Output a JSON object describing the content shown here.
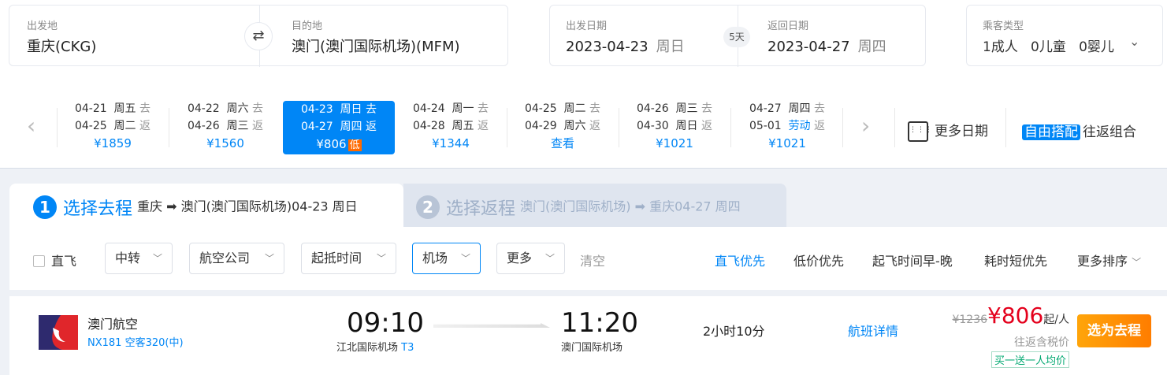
{
  "search": {
    "from_label": "出发地",
    "from_value": "重庆(CKG)",
    "to_label": "目的地",
    "to_value": "澳门(澳门国际机场)(MFM)",
    "depart_label": "出发日期",
    "depart_date": "2023-04-23",
    "depart_week": "周日",
    "days": "5天",
    "return_label": "返回日期",
    "return_date": "2023-04-27",
    "return_week": "周四",
    "pax_label": "乘客类型",
    "adults": "1成人",
    "children": "0儿童",
    "infants": "0婴儿"
  },
  "date_strip": [
    {
      "go": "04-21  周五",
      "back": "04-25  周二",
      "price": "¥1859"
    },
    {
      "go": "04-22  周六",
      "back": "04-26  周三",
      "price": "¥1560"
    },
    {
      "go": "04-23  周日",
      "back": "04-27  周四",
      "price": "¥806",
      "badge": "低"
    },
    {
      "go": "04-24  周一",
      "back": "04-28  周五",
      "price": "¥1344"
    },
    {
      "go": "04-25  周二",
      "back": "04-29  周六",
      "price": "查看"
    },
    {
      "go": "04-26  周三",
      "back": "04-30  周日",
      "price": "¥1021"
    },
    {
      "go": "04-27  周四",
      "back": "05-01",
      "back_holiday": "劳动",
      "price": "¥1021"
    }
  ],
  "go_suffix": "去",
  "back_suffix": "返",
  "more_dates": "更多日期",
  "free_combo": "自由搭配",
  "round_combo": "往返组合",
  "tabs": [
    {
      "num": "1",
      "title": "选择去程",
      "route": "重庆 ➡ 澳门(澳门国际机场)04-23 周日"
    },
    {
      "num": "2",
      "title": "选择返程",
      "route": "澳门(澳门国际机场) ➡ 重庆04-27 周四"
    }
  ],
  "filters": {
    "direct": "直飞",
    "transfer": "中转",
    "airline": "航空公司",
    "time": "起抵时间",
    "airport": "机场",
    "more": "更多",
    "clear": "清空"
  },
  "sorts": [
    "直飞优先",
    "低价优先",
    "起飞时间早-晚",
    "耗时短优先",
    "更多排序"
  ],
  "flight": {
    "airline": "澳门航空",
    "flight_no": "NX181 空客320(中)",
    "dep_time": "09:10",
    "dep_airport": "江北国际机场",
    "dep_terminal": "T3",
    "arr_time": "11:20",
    "arr_airport": "澳门国际机场",
    "duration": "2小时10分",
    "details": "航班详情",
    "old_price": "¥1236",
    "price": "¥806",
    "price_unit": "起/人",
    "price_note": "往返含税价",
    "promo": "买一送一人均价",
    "select": "选为去程"
  },
  "colors": {
    "accent": "#0086f6",
    "price": "#e4001c",
    "orange": "#ff7d00"
  }
}
